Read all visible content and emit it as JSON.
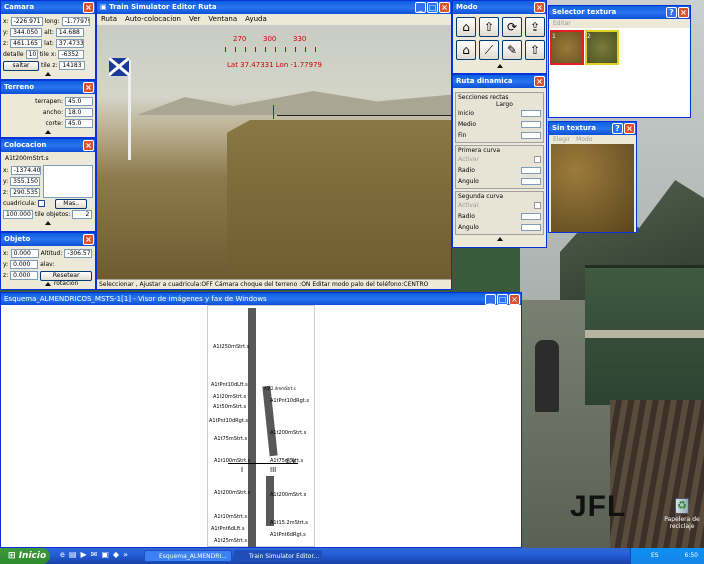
{
  "desktop": {
    "watermark": "JFL",
    "recycle_bin": "Papelera de reciclaje"
  },
  "camara": {
    "title": "Camara",
    "x": "-226.971",
    "long": "-1.77979",
    "y": "344.050",
    "alt": "14.688",
    "z": "461.165",
    "lat": "37.47339",
    "detalle": "detalle",
    "detalle_val": "10",
    "tile_x_label": "tile x:",
    "tile_x": "-6352",
    "tile_z_label": "tile z:",
    "tile_z": "14183",
    "saltar": "saltar"
  },
  "terreno": {
    "title": "Terreno",
    "terrapen": "terrapen:",
    "terrapen_val": "45.0",
    "ancho": "ancho:",
    "ancho_val": "18.0",
    "corte": "corte:",
    "corte_val": "45.0"
  },
  "colocacion": {
    "title": "Colocacion",
    "item": "A1t200mStrt.s",
    "x": "-1374.409",
    "y": "355.150",
    "z": "290.535",
    "cuadricula": "cuadricula:",
    "mas": "Mas..",
    "size_val": "100.000",
    "tile_objetos": "tile objetos:",
    "tile_objetos_val": "2"
  },
  "objeto": {
    "title": "Objeto",
    "x": "0.000",
    "altitud": "Altitud:",
    "altitud_val": "-306.578",
    "y": "0.000",
    "alav": "alav:",
    "z": "0.000",
    "resetear": "Resetear rotacion"
  },
  "editor": {
    "title": "Train Simulator Editor Ruta",
    "menu": [
      "Ruta",
      "Auto-colocacion",
      "Ver",
      "Ventana",
      "Ayuda"
    ],
    "compass": [
      "270",
      "300",
      "330"
    ],
    "coords": "Lat 37.47331  Lon -1.77979",
    "status": "Seleccionar , Ajustar a cuadricula:OFF Cámara choque del terreno :ON Editar modo palo del teléfono:CENTRO"
  },
  "modo": {
    "title": "Modo"
  },
  "ruta": {
    "title": "Ruta dinamica",
    "secciones": "Secciones rectas",
    "largo": "Largo",
    "inicio": "Inicio",
    "medio": "Medio",
    "fin": "Fin",
    "primera": "Primera curva",
    "activar1": "Activar",
    "radio1": "Radio",
    "angulo1": "Angulo",
    "segunda": "Segunda curva",
    "activar2": "Activar",
    "radio2": "Radio",
    "angulo2": "Angulo"
  },
  "selector": {
    "title": "Selector textura",
    "editar": "Editar",
    "t1": "1",
    "t2": "2"
  },
  "sintextura": {
    "title": "Sin textura",
    "elegir": "Elegir",
    "modo": "Modo"
  },
  "visor": {
    "title": "Esquema_ALMENDRICOS_MSTS-1[1] - Visor de imágenes y fax de Windows",
    "labels": [
      "A1t250mStrt.s",
      "A1tPnt10dLft.s",
      "A1t20mStrt.s",
      "A1t50mStrt.s",
      "A1tPnt10dRgt.s",
      "A1t75mStrt.s",
      "A1t100mStrt.s",
      "A1t200mStrt.s",
      "A1t10mStrt.s",
      "A1tPnt6dLft.s",
      "A1t25mStrt.s",
      "A1tPnt6dRgt.s"
    ],
    "right_labels": [
      "A1t2.4mmStrt.s",
      "A1t200mStrt.s",
      "A1tPnt10dRgt.s",
      "A1t200mStrt.s",
      "A1t75mStrt.s",
      "A1t200mStrt.s",
      "A1t15.2mStrt.s",
      "A1tPnt6dRgt.s",
      "A1tPnt6dRgt.s"
    ],
    "track_I": "I",
    "track_III": "III",
    "ev": "E.V."
  },
  "taskbar": {
    "start": "Inicio",
    "btn1": "Esquema_ALMENDRI...",
    "btn2": "Train Simulator Editor...",
    "lang": "ES",
    "clock": "6:50"
  }
}
